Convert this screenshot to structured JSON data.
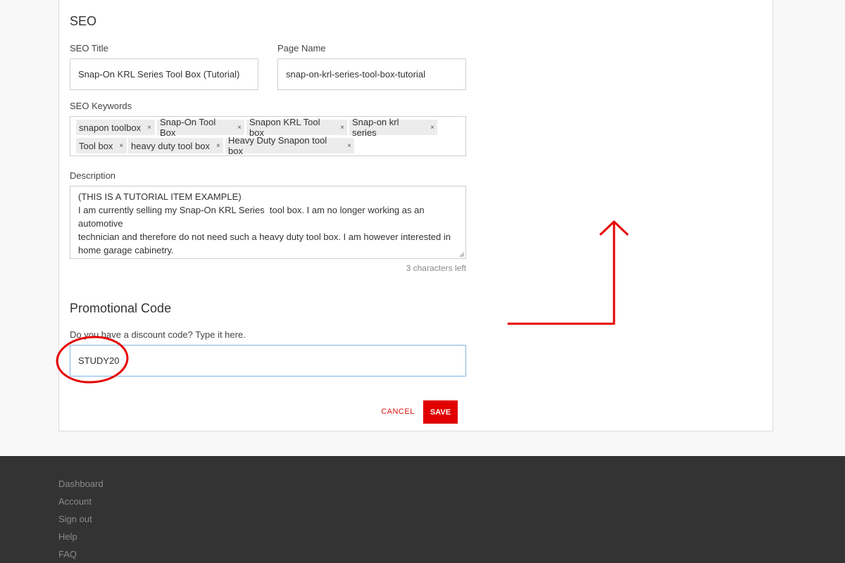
{
  "seo": {
    "heading": "SEO",
    "title_label": "SEO Title",
    "title_value": "Snap-On KRL Series Tool Box (Tutorial)",
    "page_name_label": "Page Name",
    "page_name_value": "snap-on-krl-series-tool-box-tutorial",
    "keywords_label": "SEO Keywords",
    "keywords": [
      "snapon toolbox",
      "Snap-On Tool Box",
      "Snapon KRL Tool box",
      "Snap-on krl series",
      "Tool box",
      "heavy duty tool box",
      "Heavy Duty Snapon tool box"
    ],
    "tag_remove_glyph": "×",
    "description_label": "Description",
    "description_lines": [
      "(THIS IS A TUTORIAL ITEM EXAMPLE)",
      "",
      "I am currently selling my Snap-On KRL Series  tool box. I am no longer working as an automotive",
      "technician and therefore do not need such a heavy duty tool box. I am however interested in",
      "home garage cabinetry."
    ],
    "chars_left": "3 characters left"
  },
  "promo": {
    "heading": "Promotional Code",
    "prompt": "Do you have a discount code? Type it here.",
    "code_value": "STUDY20"
  },
  "actions": {
    "cancel_label": "CANCEL",
    "save_label": "SAVE"
  },
  "footer": {
    "links": [
      "Dashboard",
      "Account",
      "Sign out",
      "Help",
      "FAQ"
    ]
  },
  "colors": {
    "accent": "#e00000",
    "annotation": "#e60000",
    "footer_bg": "#333333",
    "focus_border": "#7fb5e6"
  },
  "annotation_icons": [
    "red-circle-highlight",
    "red-arrow-pointing-up"
  ]
}
